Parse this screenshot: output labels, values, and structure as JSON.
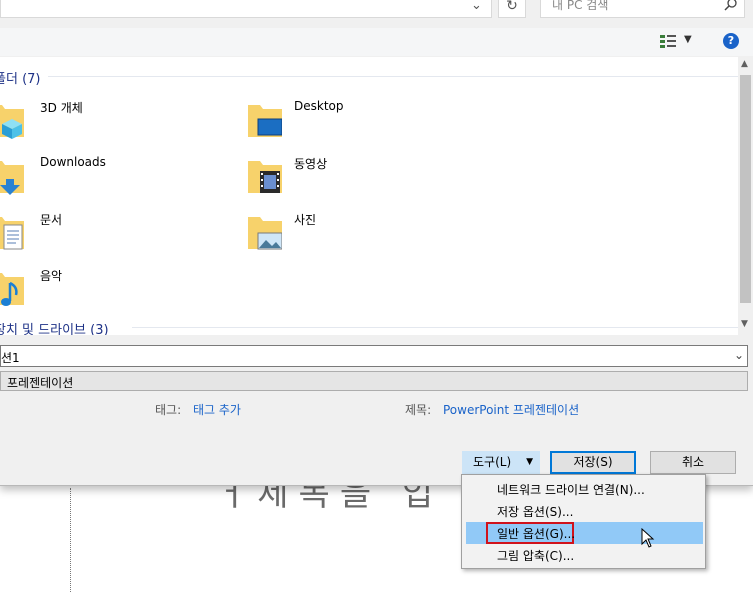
{
  "search": {
    "placeholder": "내 PC 검색"
  },
  "groups": {
    "folders": {
      "title": "폴더",
      "count": "(7)"
    },
    "drives": {
      "title": "장치 및 드라이브",
      "count": "(3)"
    }
  },
  "folders": [
    {
      "label": "3D 개체",
      "icon": "3d-objects-icon"
    },
    {
      "label": "Desktop",
      "icon": "desktop-icon"
    },
    {
      "label": "Downloads",
      "icon": "downloads-icon"
    },
    {
      "label": "동영상",
      "icon": "videos-icon"
    },
    {
      "label": "문서",
      "icon": "documents-icon"
    },
    {
      "label": "사진",
      "icon": "pictures-icon"
    },
    {
      "label": "음악",
      "icon": "music-icon"
    }
  ],
  "filename": {
    "value": "션1"
  },
  "filetype": {
    "value": "프레젠테이션"
  },
  "meta": {
    "tags_label": "태그:",
    "tags_link": "태그 추가",
    "title_label": "제목:",
    "title_value": "PowerPoint 프레젠테이션"
  },
  "buttons": {
    "tools": "도구(L)",
    "save": "저장(S)",
    "cancel": "취소"
  },
  "menu": {
    "items": [
      {
        "label": "네트워크 드라이브 연결(N)..."
      },
      {
        "label": "저장 옵션(S)..."
      },
      {
        "label": "일반 옵션(G)...",
        "highlighted": true
      },
      {
        "label": "그림 압축(C)..."
      }
    ]
  },
  "background_text": "ㅓ제목을 입",
  "colors": {
    "accent": "#0078d7",
    "menu_highlight": "#91c9f7",
    "callout_red": "#d0121b",
    "group_header": "#1e3287"
  }
}
